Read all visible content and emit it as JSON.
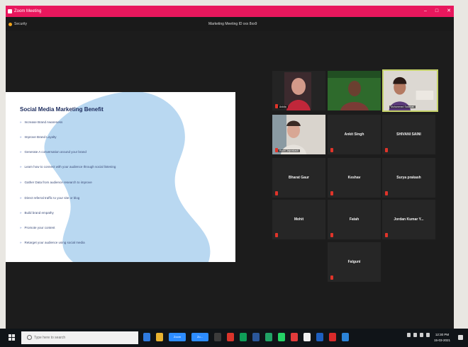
{
  "window": {
    "title": "Zoom Meeting",
    "controls": [
      "–",
      "□",
      "✕"
    ]
  },
  "meeting": {
    "security_label": "Security",
    "meeting_id": "Marketing Meeting ID xxx 8xx9"
  },
  "slide": {
    "title": "Social Media Marketing Benefit",
    "bullets": [
      "Increase Brand Awareness",
      "Improve Brand Loyalty",
      "Generate A conversation around  your brand",
      "Learn how to connect with your audience through social listening",
      "Gather Data from audience research to improve",
      "Direct referral traffic to your site or blog",
      "Build brand empathy",
      "Promote your content",
      "Retarget your audience using social media"
    ]
  },
  "participants": [
    {
      "name": "",
      "caption": "Ankita",
      "has_video": true
    },
    {
      "name": "",
      "caption": "",
      "has_video": true
    },
    {
      "name": "",
      "caption": "Mohammed Sabahat",
      "has_video": true
    },
    {
      "name": "",
      "caption": "Ruchi Jaiprakash",
      "has_video": true
    },
    {
      "name": "Ankit Singh",
      "caption": "",
      "has_video": false
    },
    {
      "name": "SHIVANI SAINI",
      "caption": "",
      "has_video": false
    },
    {
      "name": "Bharat Gaur",
      "caption": "",
      "has_video": false
    },
    {
      "name": "Keshav",
      "caption": "",
      "has_video": false
    },
    {
      "name": "Surya prakash",
      "caption": "",
      "has_video": false
    },
    {
      "name": "Mohit",
      "caption": "",
      "has_video": false
    },
    {
      "name": "Fatah",
      "caption": "",
      "has_video": false
    },
    {
      "name": "Jordan Kumar Y...",
      "caption": "",
      "has_video": false
    },
    {
      "name": "Falguni",
      "caption": "",
      "has_video": false
    }
  ],
  "taskbar": {
    "search_placeholder": "Type here to search",
    "app_labels": [
      "Zoom",
      "Zo..."
    ],
    "clock_time": "12:30 PM",
    "clock_date": "15-03-2021"
  },
  "colors": {
    "title_bar": "#e8175d",
    "window_bg": "#1c1c1c",
    "tile_bg": "#262626",
    "active_speaker": "#c6d36a",
    "muted_mic": "#e0342a",
    "slide_blob": "#b9d8f1"
  }
}
